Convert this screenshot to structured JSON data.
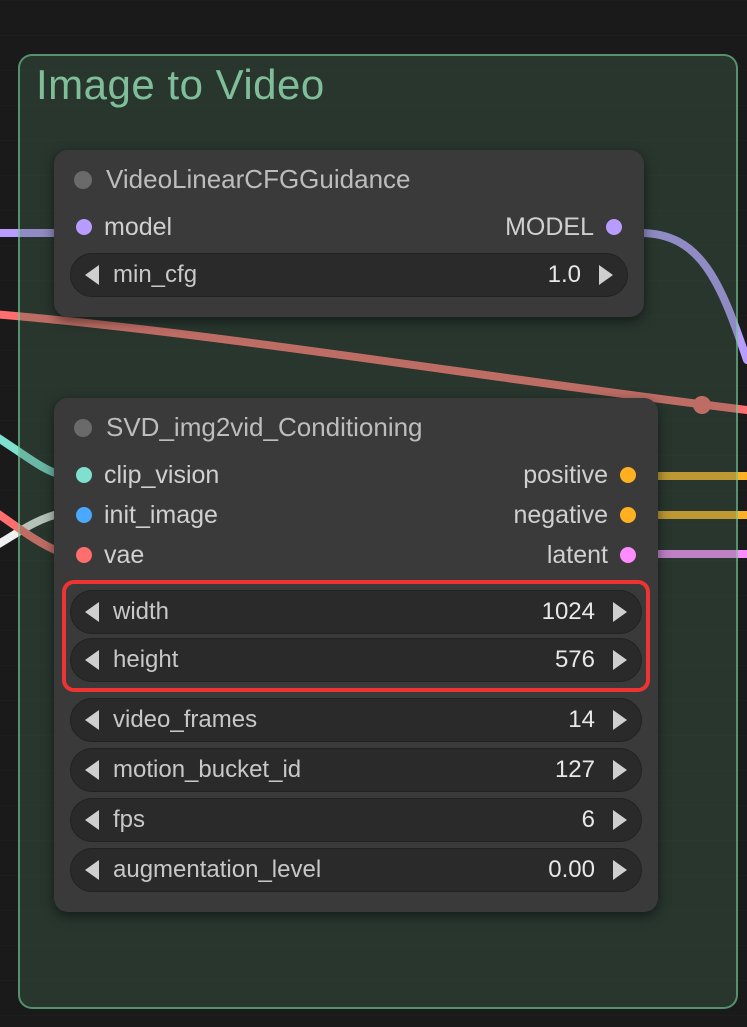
{
  "group": {
    "title": "Image to Video"
  },
  "node1": {
    "title": "VideoLinearCFGGuidance",
    "inputs": {
      "model": {
        "label": "model",
        "color": "#b99cff"
      }
    },
    "outputs": {
      "MODEL": {
        "label": "MODEL",
        "color": "#b99cff"
      }
    },
    "widgets": {
      "min_cfg": {
        "label": "min_cfg",
        "value": "1.0"
      }
    }
  },
  "node2": {
    "title": "SVD_img2vid_Conditioning",
    "inputs": {
      "clip_vision": {
        "label": "clip_vision",
        "color": "#7fe0d0"
      },
      "init_image": {
        "label": "init_image",
        "color": "#4aa8ff"
      },
      "vae": {
        "label": "vae",
        "color": "#ff6e6e"
      }
    },
    "outputs": {
      "positive": {
        "label": "positive",
        "color": "#ffb020"
      },
      "negative": {
        "label": "negative",
        "color": "#ffb020"
      },
      "latent": {
        "label": "latent",
        "color": "#ff8cff"
      }
    },
    "widgets": {
      "width": {
        "label": "width",
        "value": "1024"
      },
      "height": {
        "label": "height",
        "value": "576"
      },
      "video_frames": {
        "label": "video_frames",
        "value": "14"
      },
      "motion_bucket_id": {
        "label": "motion_bucket_id",
        "value": "127"
      },
      "fps": {
        "label": "fps",
        "value": "6"
      },
      "augmentation_level": {
        "label": "augmentation_level",
        "value": "0.00"
      }
    }
  },
  "colors": {
    "group_border": "#7adca0",
    "highlight": "#e33333"
  }
}
